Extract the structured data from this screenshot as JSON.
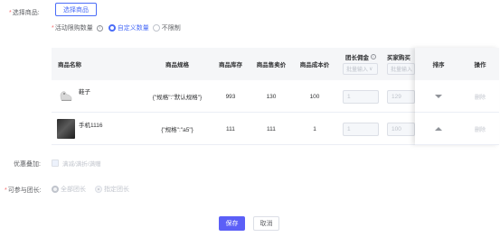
{
  "form": {
    "select_goods_label": "选择商品:",
    "select_goods_button": "选择商品",
    "qty_label": "活动限购数量",
    "qty_options": [
      "自定义数量",
      "不限制"
    ],
    "discount_label": "优惠叠加:",
    "discount_option": "满减/满折/满赠",
    "leader_label": "可参与团长:",
    "leader_options": [
      "全部团长",
      "指定团长"
    ],
    "save_button": "保存",
    "cancel_button": "取消"
  },
  "table": {
    "headers": {
      "name": "商品名称",
      "spec": "商品规格",
      "stock": "商品库存",
      "price": "商品售卖价",
      "cost": "商品成本价",
      "commission": "团长佣金",
      "commission_placeholder": "批量输入",
      "buyer": "买家购买",
      "buyer_placeholder": "批量输入",
      "sort": "排序",
      "action": "操作"
    },
    "rows": [
      {
        "name": "鞋子",
        "spec": "{\"规格\":\"默认规格\"}",
        "stock": "993",
        "price": "130",
        "cost": "100",
        "commission": "1",
        "buyer": "129",
        "action": "删除"
      },
      {
        "name": "手机1116",
        "spec": "{\"规格\":\"a5\"}",
        "stock": "111",
        "price": "111",
        "cost": "1",
        "commission": "1",
        "buyer": "100",
        "action": "删除"
      }
    ]
  },
  "colors": {
    "primary": "#5b5ff7",
    "link": "#4a6cf7",
    "required": "#f56c6c"
  }
}
